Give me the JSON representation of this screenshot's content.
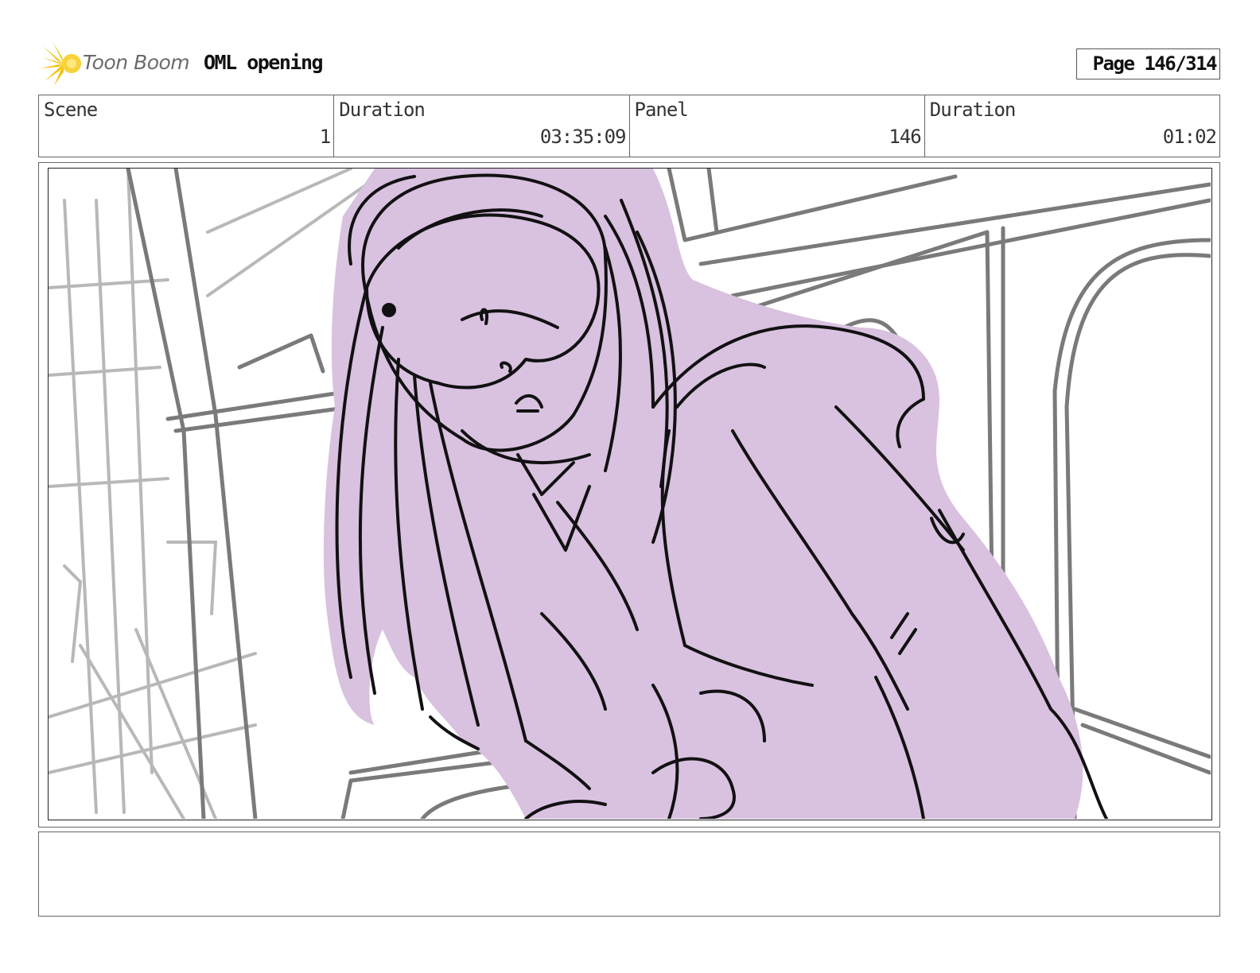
{
  "header": {
    "logo_text": "Toon Boom",
    "project_title": "OML opening",
    "page_label": "Page 146/314"
  },
  "info": {
    "scene_label": "Scene",
    "scene_value": "1",
    "scene_duration_label": "Duration",
    "scene_duration_value": "03:35:09",
    "panel_label": "Panel",
    "panel_value": "146",
    "panel_duration_label": "Duration",
    "panel_duration_value": "01:02"
  },
  "colors": {
    "fill": "#d9c1e0",
    "ink": "#111111",
    "background_lines": "#7a7a7a",
    "light_lines": "#b5b5b5",
    "logo_yellow": "#f2c200"
  },
  "notes": {
    "text": ""
  }
}
